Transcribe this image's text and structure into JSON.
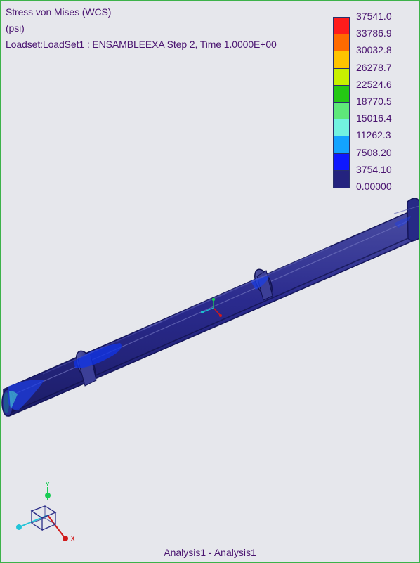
{
  "plot": {
    "title": "Stress von Mises (WCS)",
    "units": "(psi)",
    "loadset": "Loadset:LoadSet1 :  ENSAMBLEEXA Step 2, Time  1.0000E+00"
  },
  "legend": {
    "values": [
      "37541.0",
      "33786.9",
      "30032.8",
      "26278.7",
      "22524.6",
      "18770.5",
      "15016.4",
      "11262.3",
      "7508.20",
      "3754.10",
      "0.00000"
    ],
    "colors": [
      "#ff1c1c",
      "#ff6a00",
      "#ffc400",
      "#c8f000",
      "#24c814",
      "#5ee87a",
      "#72f2e0",
      "#13a3ff",
      "#0e18ff",
      "#24237f"
    ]
  },
  "triad": {
    "x_label": "X",
    "y_label": "Y"
  },
  "footer": {
    "analysis": "Analysis1 - Analysis1"
  }
}
